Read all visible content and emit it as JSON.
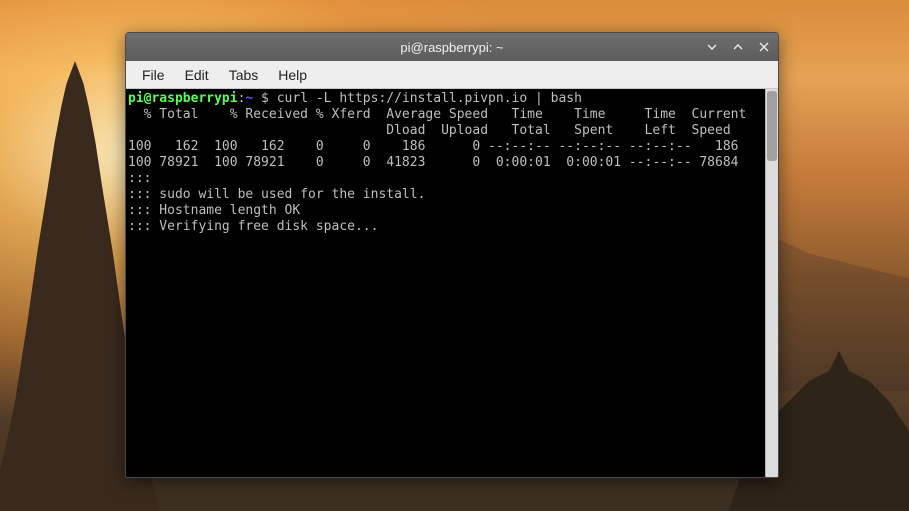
{
  "window": {
    "title": "pi@raspberrypi: ~"
  },
  "menubar": {
    "file": "File",
    "edit": "Edit",
    "tabs": "Tabs",
    "help": "Help"
  },
  "prompt": {
    "user_host": "pi@raspberrypi",
    "separator": ":",
    "path": "~",
    "sigil": " $ "
  },
  "terminal": {
    "command": "curl -L https://install.pivpn.io | bash",
    "lines": {
      "h1": "  % Total    % Received % Xferd  Average Speed   Time    Time     Time  Current",
      "h2": "                                 Dload  Upload   Total   Spent    Left  Speed",
      "r1": "100   162  100   162    0     0    186      0 --:--:-- --:--:-- --:--:--   186",
      "r2": "100 78921  100 78921    0     0  41823      0  0:00:01  0:00:01 --:--:-- 78684",
      "m1": ":::",
      "m2": "::: sudo will be used for the install.",
      "m3": "::: Hostname length OK",
      "m4": "::: Verifying free disk space..."
    }
  }
}
